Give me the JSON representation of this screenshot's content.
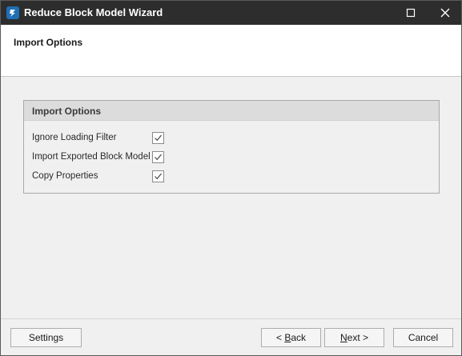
{
  "window": {
    "title": "Reduce Block Model Wizard"
  },
  "header": {
    "page_title": "Import Options"
  },
  "group": {
    "title": "Import Options",
    "options": [
      {
        "label": "Ignore Loading Filter",
        "checked": true
      },
      {
        "label": "Import Exported Block Model",
        "checked": true
      },
      {
        "label": "Copy Properties",
        "checked": true
      }
    ]
  },
  "footer": {
    "settings_label": "Settings",
    "back_prefix": "< ",
    "back_mnemonic": "B",
    "back_rest": "ack",
    "next_mnemonic": "N",
    "next_rest": "ext >",
    "cancel_label": "Cancel"
  },
  "icons": {
    "app": "app-logo-icon",
    "maximize": "maximize-icon",
    "close": "close-icon",
    "check": "checkmark-icon"
  },
  "colors": {
    "titlebar": "#2d2d2d",
    "app_icon": "#1f6fb5",
    "dialog_bg": "#f0f0f0",
    "group_header": "#dcdcdc"
  }
}
